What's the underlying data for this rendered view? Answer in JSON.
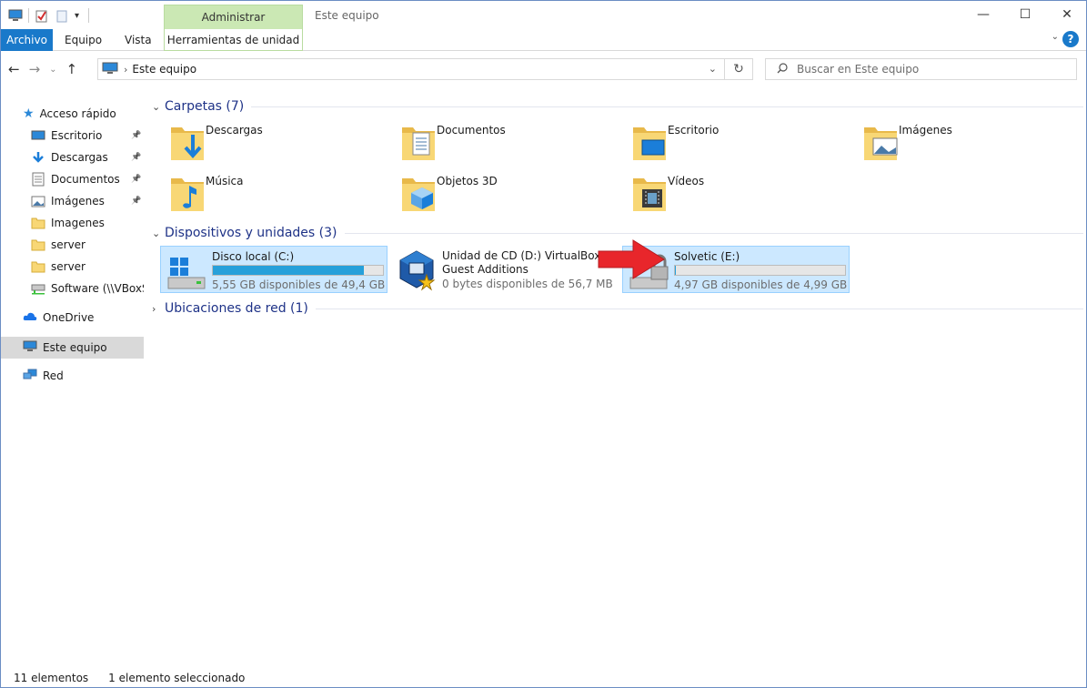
{
  "window": {
    "title": "Este equipo",
    "context_tab_group": "Administrar",
    "minimize": "—",
    "maximize": "☐",
    "close": "✕"
  },
  "ribbon": {
    "tabs": [
      "Archivo",
      "Equipo",
      "Vista",
      "Herramientas de unidad"
    ],
    "help": "?"
  },
  "address": {
    "path": "Este equipo",
    "search_placeholder": "Buscar en Este equipo"
  },
  "sidebar": {
    "quick_access": "Acceso rápido",
    "items": [
      {
        "label": "Escritorio",
        "icon": "desktop-icon",
        "pinned": true
      },
      {
        "label": "Descargas",
        "icon": "download-icon",
        "pinned": true
      },
      {
        "label": "Documentos",
        "icon": "document-icon",
        "pinned": true
      },
      {
        "label": "Imágenes",
        "icon": "pictures-icon",
        "pinned": true
      },
      {
        "label": "Imagenes",
        "icon": "folder-icon",
        "pinned": false
      },
      {
        "label": "server",
        "icon": "folder-icon",
        "pinned": false
      },
      {
        "label": "server",
        "icon": "folder-icon",
        "pinned": false
      },
      {
        "label": "Software (\\\\VBoxSv",
        "icon": "network-drive-icon",
        "pinned": false
      }
    ],
    "onedrive": "OneDrive",
    "this_pc": "Este equipo",
    "network": "Red"
  },
  "groups": {
    "folders": "Carpetas (7)",
    "devices": "Dispositivos y unidades (3)",
    "network": "Ubicaciones de red (1)"
  },
  "folders": [
    {
      "label": "Descargas",
      "icon": "downloads-folder-icon"
    },
    {
      "label": "Documentos",
      "icon": "documents-folder-icon"
    },
    {
      "label": "Escritorio",
      "icon": "desktop-folder-icon"
    },
    {
      "label": "Imágenes",
      "icon": "pictures-folder-icon"
    },
    {
      "label": "Música",
      "icon": "music-folder-icon"
    },
    {
      "label": "Objetos 3D",
      "icon": "3d-objects-folder-icon"
    },
    {
      "label": "Vídeos",
      "icon": "videos-folder-icon"
    }
  ],
  "drives": [
    {
      "name": "Disco local (C:)",
      "free": "5,55 GB disponibles de 49,4 GB",
      "used_fraction": 0.89,
      "icon": "windows-drive-icon"
    },
    {
      "name": "Unidad de CD (D:) VirtualBox Guest Additions",
      "free": "0 bytes disponibles de 56,7 MB",
      "icon": "virtualbox-cd-icon"
    },
    {
      "name": "Solvetic (E:)",
      "free": "4,97 GB disponibles de 4,99 GB",
      "used_fraction": 0.004,
      "icon": "locked-drive-icon"
    }
  ],
  "status": {
    "count": "11 elementos",
    "selection": "1 elemento seleccionado"
  },
  "colors": {
    "accent": "#1979ca",
    "selection": "#cce8ff",
    "bar_fill": "#26a0da",
    "group_title": "#1e3287",
    "arrow": "#e8262b"
  }
}
